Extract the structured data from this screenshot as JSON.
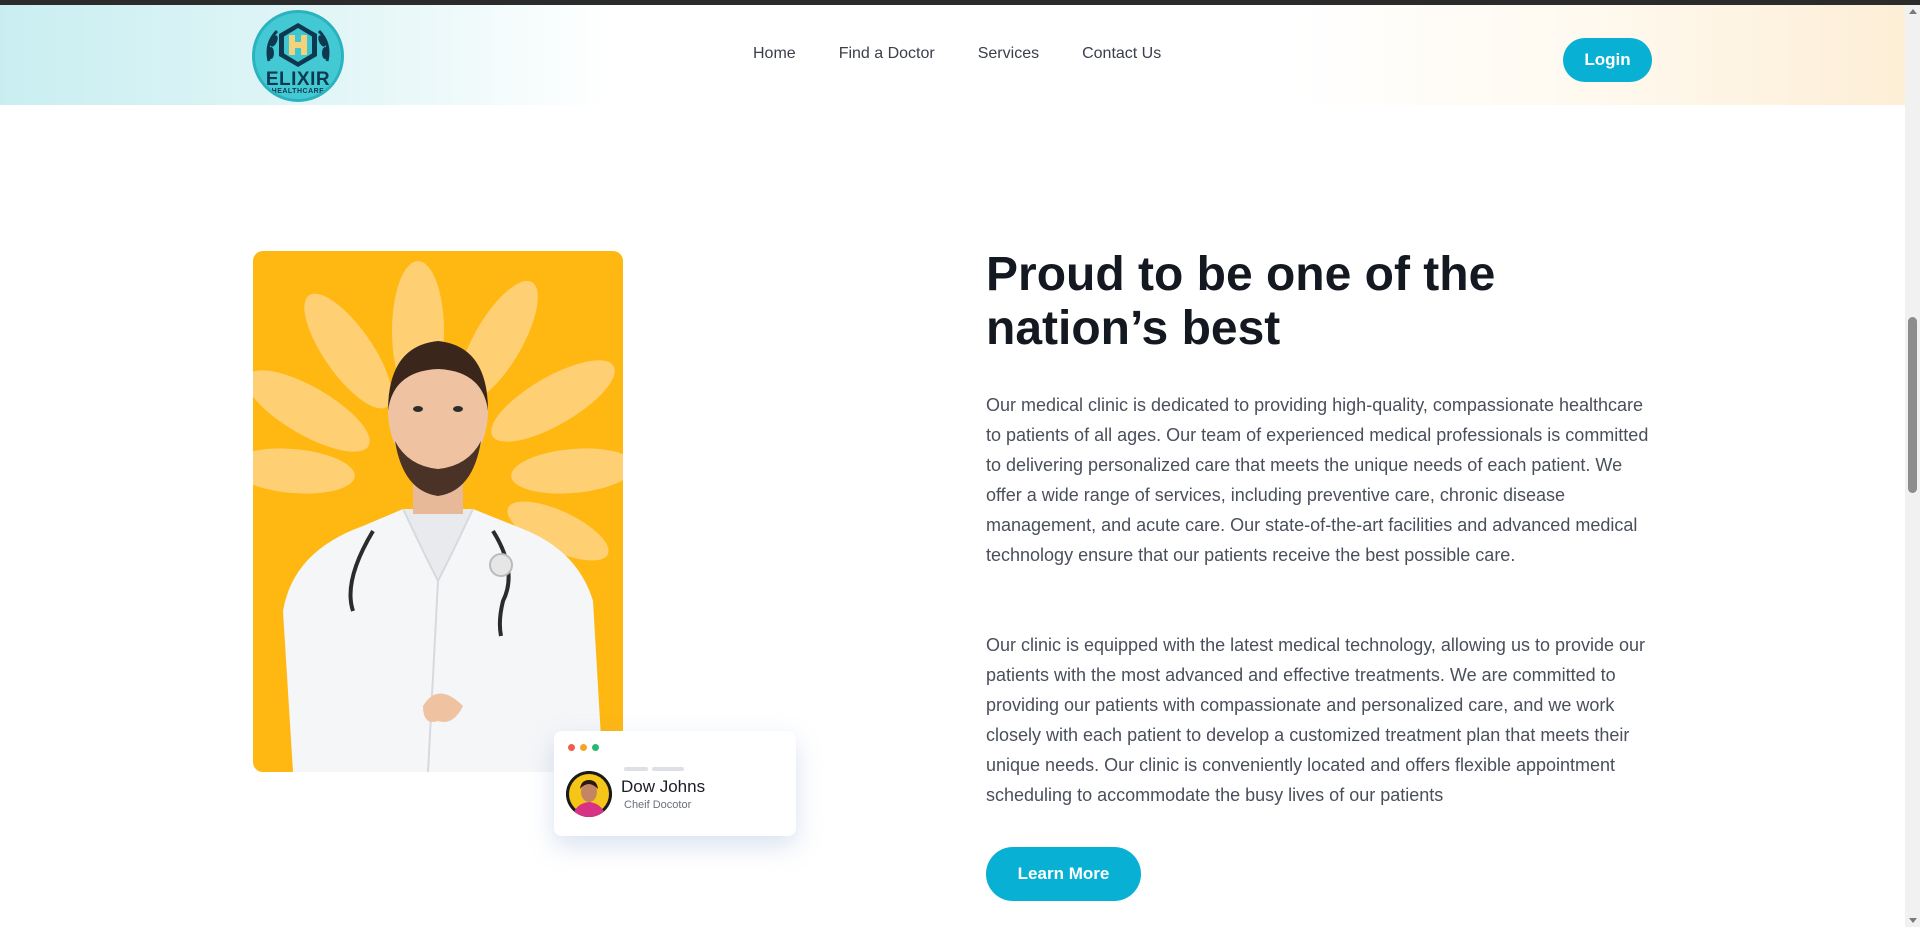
{
  "header": {
    "logo": {
      "name": "ELIXIR",
      "subtitle": "HEALTHCARE",
      "icon": "hospital-h-icon"
    },
    "nav": [
      {
        "label": "Home"
      },
      {
        "label": "Find a Doctor"
      },
      {
        "label": "Services"
      },
      {
        "label": "Contact Us"
      }
    ],
    "login_label": "Login"
  },
  "about": {
    "heading": "Proud to be one of the nation’s best",
    "paragraphs": [
      "Our medical clinic is dedicated to providing high-quality, compassionate healthcare to patients of all ages. Our team of experienced medical professionals is committed to delivering personalized care that meets the unique needs of each patient. We offer a wide range of services, including preventive care, chronic disease management, and acute care. Our state-of-the-art facilities and advanced medical technology ensure that our patients receive the best possible care.",
      "Our clinic is equipped with the latest medical technology, allowing us to provide our patients with the most advanced and effective treatments. We are committed to providing our patients with compassionate and personalized care, and we work closely with each patient to develop a customized treatment plan that meets their unique needs. Our clinic is conveniently located and offers flexible appointment scheduling to accommodate the busy lives of our patients"
    ],
    "cta_label": "Learn More"
  },
  "doctor_card": {
    "name": "Dow Johns",
    "role": "Cheif Docotor",
    "dot_colors": [
      "#f25c4d",
      "#f5a524",
      "#2bb673"
    ]
  },
  "theme": {
    "accent": "#08b0d4",
    "photo_background": "#ffb712"
  }
}
